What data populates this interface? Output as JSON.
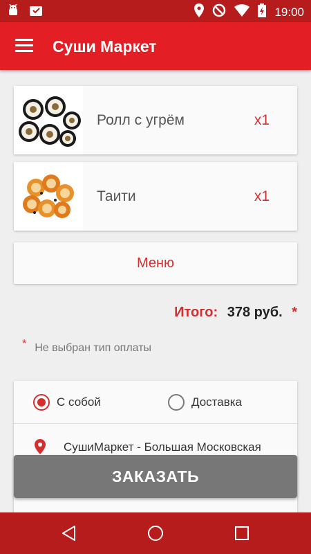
{
  "status_bar": {
    "time": "19:00",
    "icons": [
      "android-icon",
      "download-icon",
      "location-icon",
      "do-not-disturb-icon",
      "wifi-icon",
      "battery-icon"
    ]
  },
  "app_bar": {
    "title": "Суши Маркет",
    "menu_icon": "hamburger-icon"
  },
  "cart": {
    "items": [
      {
        "name": "Ролл с угрём",
        "quantity": "x1",
        "image": "sushi-roll-image"
      },
      {
        "name": "Таити",
        "quantity": "x1",
        "image": "baked-roll-image"
      }
    ]
  },
  "menu_button": {
    "label": "Меню"
  },
  "total": {
    "label": "Итого:",
    "value": "378 руб.",
    "required_mark": "*"
  },
  "payment_note": {
    "mark": "*",
    "text": "Не выбран тип оплаты"
  },
  "delivery": {
    "options": [
      {
        "label": "С собой",
        "selected": true
      },
      {
        "label": "Доставка",
        "selected": false
      }
    ],
    "address": "СушиМаркет - Большая Московская"
  },
  "order_button": {
    "label": "ЗАКАЗАТЬ"
  },
  "colors": {
    "accent": "#e41e25",
    "status_bar": "#b71c1c",
    "text_accent": "#d32f2f",
    "button_gray": "#777777"
  }
}
